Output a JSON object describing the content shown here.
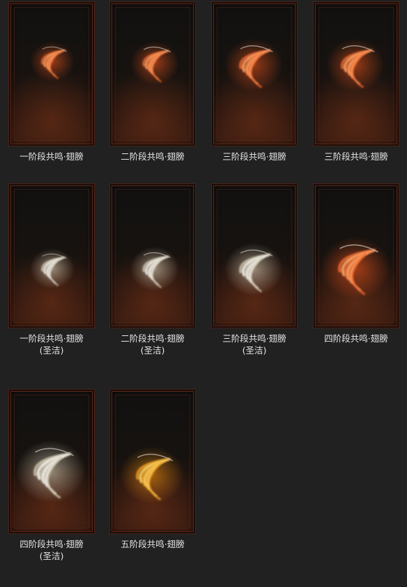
{
  "items": [
    {
      "line1": "一阶段共鸣·翅膀",
      "line2": "",
      "wing_icon": "wing-fire-stage1-icon",
      "palette": "fire"
    },
    {
      "line1": "二阶段共鸣·翅膀",
      "line2": "",
      "wing_icon": "wing-fire-stage2-icon",
      "palette": "fire"
    },
    {
      "line1": "三阶段共鸣·翅膀",
      "line2": "",
      "wing_icon": "wing-fire-stage3-icon",
      "palette": "fire"
    },
    {
      "line1": "三阶段共鸣·翅膀",
      "line2": "",
      "wing_icon": "wing-fire-stage3b-icon",
      "palette": "fire"
    },
    {
      "line1": "一阶段共鸣·翅膀",
      "line2": "(圣洁)",
      "wing_icon": "wing-holy-stage1-icon",
      "palette": "holy"
    },
    {
      "line1": "二阶段共鸣·翅膀",
      "line2": "(圣洁)",
      "wing_icon": "wing-holy-stage2-icon",
      "palette": "holy"
    },
    {
      "line1": "三阶段共鸣·翅膀",
      "line2": "(圣洁)",
      "wing_icon": "wing-holy-stage3-icon",
      "palette": "holy"
    },
    {
      "line1": "四阶段共鸣·翅膀",
      "line2": "",
      "wing_icon": "wing-fire-stage4-icon",
      "palette": "fire"
    },
    {
      "line1": "四阶段共鸣·翅膀",
      "line2": "(圣洁)",
      "wing_icon": "wing-holy-stage4-icon",
      "palette": "holy"
    },
    {
      "line1": "五阶段共鸣·翅膀",
      "line2": "",
      "wing_icon": "wing-gold-stage5-icon",
      "palette": "gold"
    }
  ],
  "palettes": {
    "fire": {
      "glow": "#ff5a1e",
      "feather": "#f06a30",
      "highlight": "#ffb070"
    },
    "holy": {
      "glow": "#e8e0c8",
      "feather": "#cfc6ad",
      "highlight": "#ffffff"
    },
    "gold": {
      "glow": "#ff9a10",
      "feather": "#f0a020",
      "highlight": "#ffe070"
    }
  }
}
